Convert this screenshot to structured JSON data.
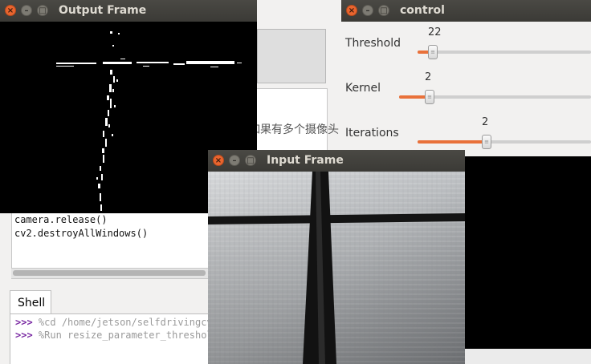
{
  "background_ide": {
    "chinese_text": "如果有多个摄像头",
    "code_lines": [
      "camera.release()",
      "cv2.destroyAllWindows()"
    ],
    "shell_tab_label": "Shell",
    "shell_lines": [
      {
        "prompt": ">>>",
        "text": "%cd /home/jetson/selfdrivingcv"
      },
      {
        "prompt": ">>>",
        "text": "%Run resize_parameter_threshold"
      }
    ]
  },
  "windows": {
    "output": {
      "title": "Output Frame"
    },
    "input": {
      "title": "Input Frame"
    },
    "control": {
      "title": "control"
    }
  },
  "trackbars": [
    {
      "label": "Threshold",
      "value": "22",
      "fraction": 0.09
    },
    {
      "label": "Kernel",
      "value": "2",
      "fraction": 0.16
    },
    {
      "label": "Iterations",
      "value": "2",
      "fraction": 0.4
    }
  ],
  "window_buttons": {
    "close": "×",
    "minimize": "–",
    "maximize": "□"
  },
  "colors": {
    "accent": "#e9713a",
    "title_bar": "#3c3b37",
    "close_button": "#e9652f"
  }
}
